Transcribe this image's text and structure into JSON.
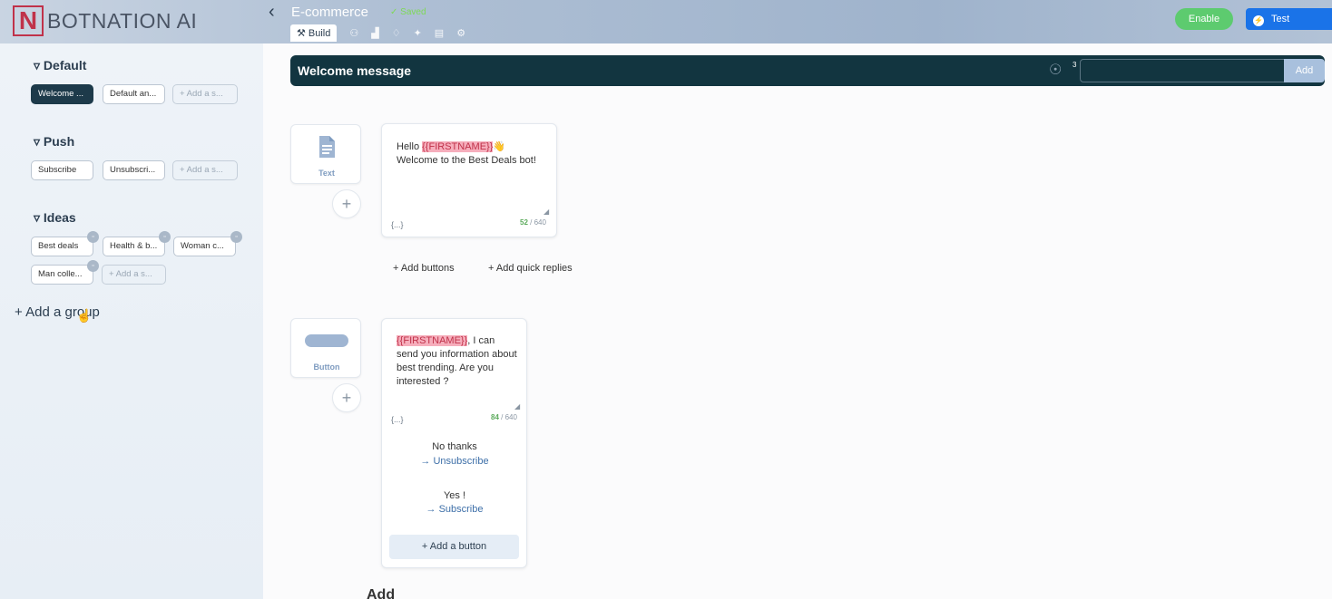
{
  "header": {
    "logo_text": "BOTNATION AI",
    "logo_letter": "N",
    "bot_name": "E-commerce",
    "status": "✓ Saved",
    "tab_build": "Build",
    "enable_label": "Enable",
    "test_label": "Test"
  },
  "sidebar": {
    "groups": [
      {
        "title": "Default",
        "chips": [
          "Welcome ...",
          "Default an...",
          "Add a s..."
        ]
      },
      {
        "title": "Push",
        "chips": [
          "Subscribe",
          "Unsubscri...",
          "Add a s..."
        ]
      },
      {
        "title": "Ideas",
        "chips": [
          "Best deals",
          "Health & b...",
          "Woman c...",
          "Man colle...",
          "Add a s..."
        ]
      }
    ],
    "add_group": "Add a group"
  },
  "block": {
    "title": "Welcome message",
    "robot_count": "3",
    "add_label": "Add"
  },
  "text_card": {
    "type_label": "Text",
    "line1_prefix": "Hello ",
    "variable": "{{FIRSTNAME}}",
    "emoji": "👋",
    "line2": "Welcome to the Best Deals bot!",
    "var_btn": "{...}",
    "count": "52",
    "max": "/ 640",
    "add_buttons": "Add buttons",
    "add_quick_replies": "Add quick replies"
  },
  "button_card": {
    "type_label": "Button",
    "variable": "{{FIRSTNAME}}",
    "text_rest": ", I can send you information about best trending. Are you interested ?",
    "var_btn": "{...}",
    "count": "84",
    "max": "/ 640",
    "buttons": [
      {
        "title": "No thanks",
        "action": "Unsubscribe"
      },
      {
        "title": "Yes !",
        "action": "Subscribe"
      }
    ],
    "add_button": "Add a button"
  },
  "bottom_label": "Add"
}
